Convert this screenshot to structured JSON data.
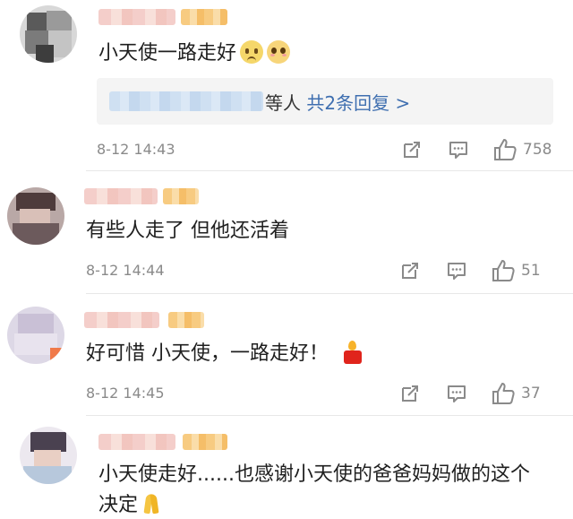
{
  "comments": [
    {
      "text": "小天使一路走好",
      "timestamp": "8-12 14:43",
      "likes": "758",
      "emojis": [
        "crying-face-emoji",
        "pleading-face-emoji"
      ],
      "replies": {
        "suffix": "等人",
        "link": "共2条回复 >"
      }
    },
    {
      "text": "有些人走了 但他还活着",
      "timestamp": "8-12 14:44",
      "likes": "51"
    },
    {
      "text": "好可惜 小天使，一路走好！",
      "timestamp": "8-12 14:45",
      "likes": "37",
      "emojis": [
        "candle-emoji"
      ]
    },
    {
      "text_line1": "小天使走好......也感谢小天使的爸爸妈妈做的这个",
      "text_line2": "决定",
      "emojis": [
        "praying-hands-emoji"
      ]
    }
  ],
  "icons": {
    "share": "share-icon",
    "comment": "comment-icon",
    "like": "thumbs-up-icon"
  },
  "colors": {
    "link": "#3f6fb0",
    "meta": "#8a8a8a",
    "reply_bg": "#f4f4f4"
  }
}
